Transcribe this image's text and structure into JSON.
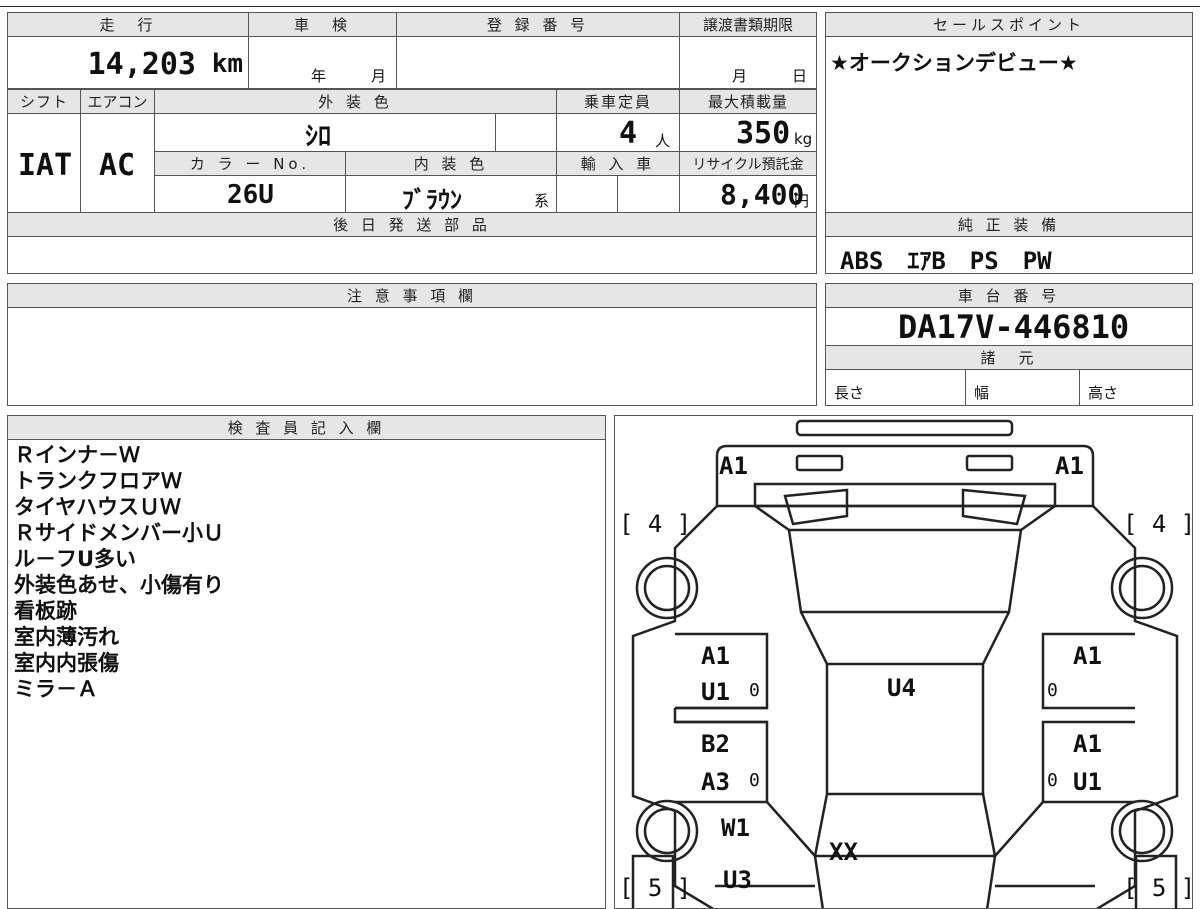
{
  "top_strip": "",
  "headers": {
    "mileage": "走　行",
    "inspection": "車　検",
    "registration_no": "登 録 番 号",
    "transfer_deadline": "譲渡書類期限",
    "sales_point": "セールスポイント",
    "shift": "シフト",
    "aircon": "エアコン",
    "exterior_color": "外 装 色",
    "capacity": "乗車定員",
    "max_load": "最大積載量",
    "color_no": "カ ラ ー No.",
    "interior_color": "内 装 色",
    "import": "輸 入 車",
    "recycle": "リサイクル預託金",
    "later_parts": "後 日 発 送 部 品",
    "genuine_equipment": "純 正 装 備",
    "notes": "注 意 事 項 欄",
    "chassis_no": "車 台 番 号",
    "specs": "諸　元",
    "inspector_notes": "検 査 員 記 入 欄"
  },
  "values": {
    "mileage": "14,203",
    "mileage_unit": "km",
    "inspection_year": "年",
    "inspection_month": "月",
    "deadline_month": "月",
    "deadline_day": "日",
    "sales_point_text": "★オークションデビュー★",
    "shift": "IAT",
    "aircon": "AC",
    "exterior_color": "ｼﾛ",
    "capacity": "4",
    "capacity_unit": "人",
    "max_load": "350",
    "max_load_unit": "kg",
    "color_no": "26U",
    "interior_color": "ﾌﾞﾗｳﾝ",
    "interior_suffix": "系",
    "recycle": "8,400",
    "recycle_unit": "円",
    "equipment": "ABS　ｴｱB　PS　PW",
    "chassis_no": "DA17V-446810",
    "spec_length": "長さ",
    "spec_width": "幅",
    "spec_height": "高さ"
  },
  "inspector_lines": [
    "Ｒインナ－Ｗ",
    "トランクフロアＷ",
    "タイヤハウスＵＷ",
    "Ｒサイドメンバー小Ｕ",
    "ル－フU多い",
    "外装色あせ、小傷有り",
    "看板跡",
    "室内薄汚れ",
    "室内内張傷",
    "ミラ－Ａ"
  ],
  "diagram": {
    "front_left": "A1",
    "front_right": "A1",
    "tire_fl": "[ 4 ]",
    "tire_fr": "[ 4 ]",
    "tire_rl": "[ 5 ]",
    "tire_rr": "[ 5 ]",
    "door_fl_1": "A1",
    "door_fl_2": "U1",
    "door_fl_mark": "0",
    "door_fr_1": "A1",
    "door_fr_mark": "0",
    "roof": "U4",
    "door_rl_1": "B2",
    "door_rl_2": "A3",
    "door_rl_mark": "0",
    "door_rr_1": "A1",
    "door_rr_2": "U1",
    "door_rr_mark": "0",
    "rear_quarter": "W1",
    "rear_lower": "U3",
    "rear_glass": "XX"
  }
}
